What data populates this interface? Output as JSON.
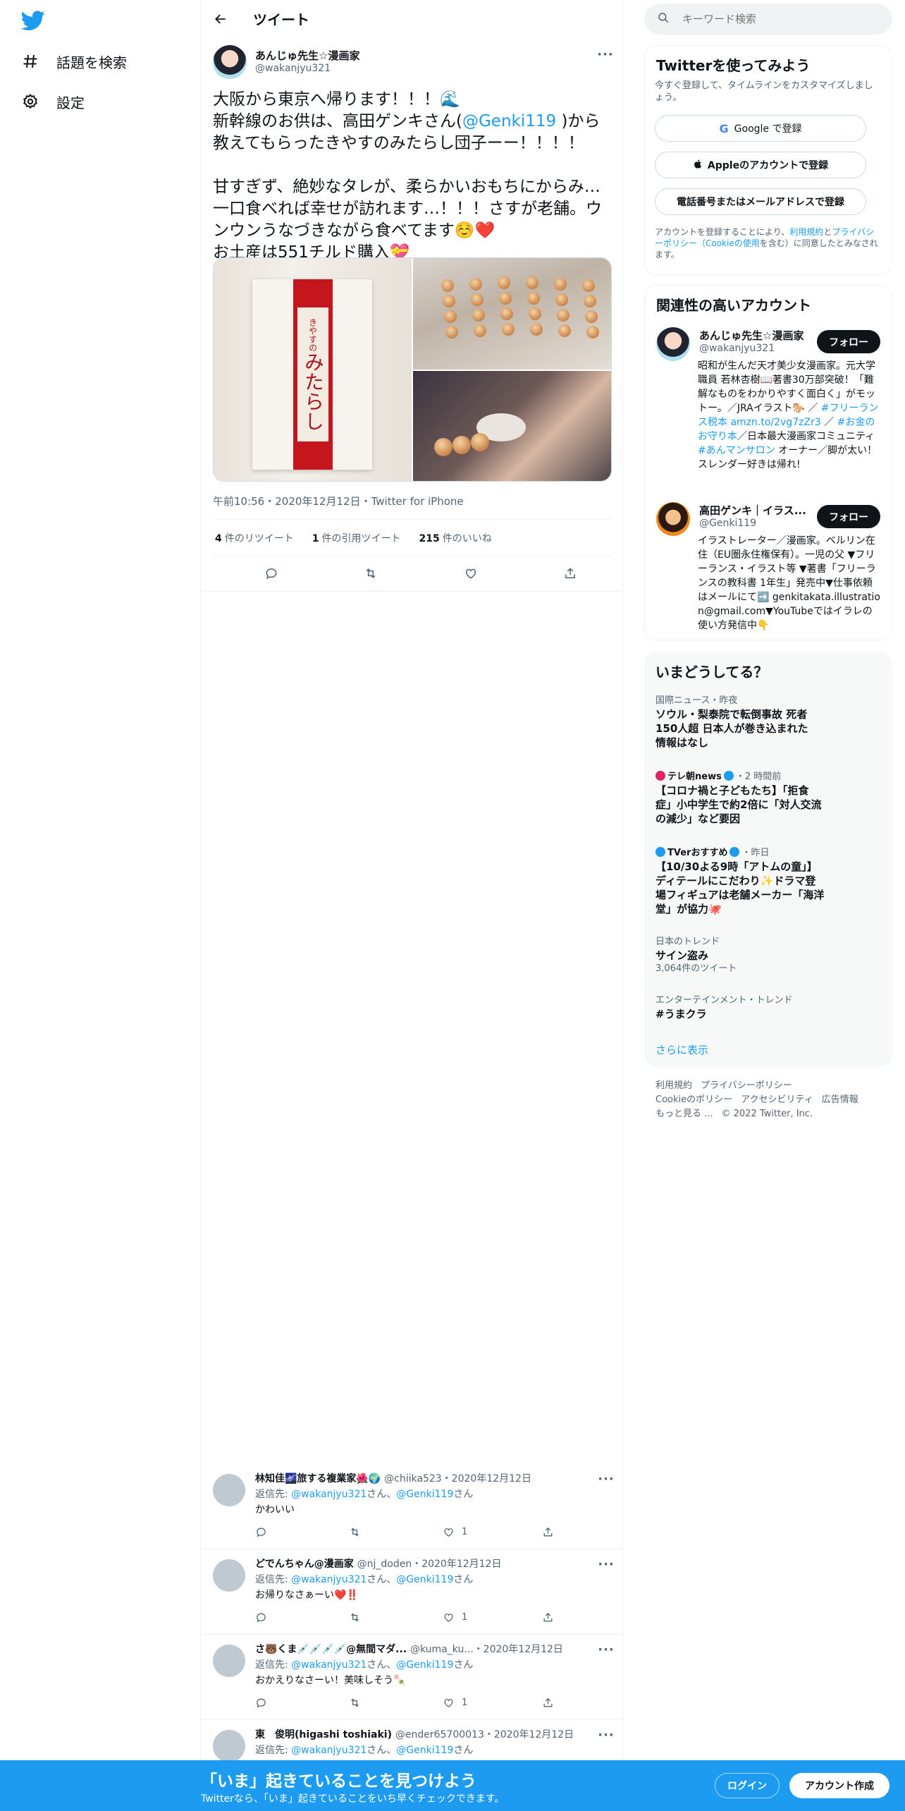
{
  "nav": {
    "explore_label": "話題を検索",
    "settings_label": "設定"
  },
  "header": {
    "title": "ツイート"
  },
  "tweet": {
    "author_name": "あんじゅ先生☆漫画家",
    "author_handle": "@wakanjyu321",
    "text_line1": "大阪から東京へ帰ります！！！🌊",
    "text_line2a": "新幹線のお供は、高田ゲンキさん(",
    "text_mention": "@Genki119",
    "text_line2b": " )から",
    "text_line3": "教えてもらったきやすのみたらし団子ーー！！！！",
    "text_line4": "甘すぎず、絶妙なタレが、柔らかいおもちにからみ…",
    "text_line5": "一口食べれば幸せが訪れます…！！！さすが老舗。ウ",
    "text_line6": "ンウンうなづきながら食べてます☺️❤️",
    "text_line7": "お土産は551チルド購入💝",
    "meta": "午前10:56・2020年12月12日・Twitter for iPhone",
    "box_label": "みたらし",
    "box_small": "きやすの",
    "retweets_count": "4",
    "retweets_label": "件のリツイート",
    "quotes_count": "1",
    "quotes_label": "件の引用ツイート",
    "likes_count": "215",
    "likes_label": "件のいいね"
  },
  "replies": [
    {
      "name": "林知佳🌌旅する複業家🌺🌍",
      "handle": "@chiika523",
      "date": "・2020年12月12日",
      "reply_to_label": "返信先: ",
      "reply_to_1": "@wakanjyu321",
      "reply_to_mid": "さん、",
      "reply_to_2": "@Genki119",
      "reply_to_end": "さん",
      "text": "かわいい",
      "likes": "1"
    },
    {
      "name": "どでんちゃん@漫画家",
      "handle": "@nj_doden",
      "date": "・2020年12月12日",
      "reply_to_label": "返信先: ",
      "reply_to_1": "@wakanjyu321",
      "reply_to_mid": "さん、",
      "reply_to_2": "@Genki119",
      "reply_to_end": "さん",
      "text": "お帰りなさぁーい❤️‼️",
      "likes": "1"
    },
    {
      "name": "さ🐻くま💉💉💉💉@無間マダ...",
      "handle": "@kuma_ku...",
      "date": "・2020年12月12日",
      "reply_to_label": "返信先: ",
      "reply_to_1": "@wakanjyu321",
      "reply_to_mid": "さん、",
      "reply_to_2": "@Genki119",
      "reply_to_end": "さん",
      "text": "おかえりなさーい！美味しそう🍡",
      "likes": "1"
    },
    {
      "name": "東　俊明(higashi toshiaki)",
      "handle": "@ender65700013",
      "date": "・2020年12月12日",
      "reply_to_label": "返信先: ",
      "reply_to_1": "@wakanjyu321",
      "reply_to_mid": "さん、",
      "reply_to_2": "@Genki119",
      "reply_to_end": "さん"
    }
  ],
  "search": {
    "placeholder": "キーワード検索"
  },
  "signup_card": {
    "title": "Twitterを使ってみよう",
    "subtitle": "今すぐ登録して、タイムラインをカスタマイズしましょう。",
    "google_label": "Google で登録",
    "apple_label": "Appleのアカウントで登録",
    "phone_label": "電話番号またはメールアドレスで登録",
    "terms_pre": "アカウントを登録することにより、",
    "terms_link1": "利用規約",
    "terms_and": "と",
    "terms_link2": "プライバシーポリシー（Cookieの使用",
    "terms_post": "を含む）に同意したとみなされます。"
  },
  "related": {
    "title": "関連性の高いアカウント",
    "accounts": [
      {
        "name": "あんじゅ先生☆漫画家",
        "handle": "@wakanjyu321",
        "follow_label": "フォロー",
        "bio_1": "昭和が生んだ天才美少女漫画家。元大学職員 若林杏樹📖著書30万部突破！「難解なものをわかりやすく面白く」がモットー。／JRAイラスト🐎 ／ ",
        "bio_link1": "#フリーランス税本 amzn.to/2vg7zZr3",
        "bio_2": " ／ ",
        "bio_link2": "#お金のお守り本",
        "bio_3": "／日本最大漫画家コミュニティ ",
        "bio_link3": "#あんマンサロン",
        "bio_4": " オーナー／脚が太い！スレンダー好きは帰れ!"
      },
      {
        "name": "高田ゲンキ｜イラス...",
        "handle": "@Genki119",
        "follow_label": "フォロー",
        "bio": "イラストレーター／漫画家。ベルリン在住（EU圏永住権保有）。一児の父 ▼フリーランス・イラスト等 ▼著書「フリーランスの教科書 1年生」発売中▼仕事依頼はメールにて➡️ genkitakata.illustration@gmail.com▼YouTubeではイラレの使い方発信中👇"
      }
    ]
  },
  "trends": {
    "title": "いまどうしてる？",
    "items": [
      {
        "meta": "国際ニュース・昨夜",
        "title": "ソウル・梨泰院で転倒事故 死者150人超 日本人が巻き込まれた情報はなし"
      },
      {
        "source": "テレ朝news",
        "meta": "・2 時間前",
        "title": "【コロナ禍と子どもたち】「拒食症」小中学生で約2倍に「対人交流の減少」など要因"
      },
      {
        "source": "TVerおすすめ",
        "meta": "・昨日",
        "title": "【10/30よる9時「アトムの童」】ディテールにこだわり✨ドラマ登場フィギュアは老舗メーカー「海洋堂」が協力🐙"
      },
      {
        "meta": "日本のトレンド",
        "title": "サイン盗み",
        "count": "3,064件のツイート"
      },
      {
        "meta": "エンターテインメント・トレンド",
        "title": "#うまクラ"
      }
    ],
    "show_more": "さらに表示"
  },
  "footer": {
    "links": [
      "利用規約",
      "プライバシーポリシー",
      "Cookieのポリシー",
      "アクセシビリティ",
      "広告情報",
      "もっと見る ..."
    ],
    "copyright": "© 2022 Twitter, Inc."
  },
  "bottom_bar": {
    "headline": "「いま」起きていることを見つけよう",
    "sub": "Twitterなら、「いま」起きていることをいち早くチェックできます。",
    "login_label": "ログイン",
    "signup_label": "アカウント作成"
  },
  "colors": {
    "accent": "#1d9bf0",
    "text": "#0f1419",
    "muted": "#536471"
  }
}
